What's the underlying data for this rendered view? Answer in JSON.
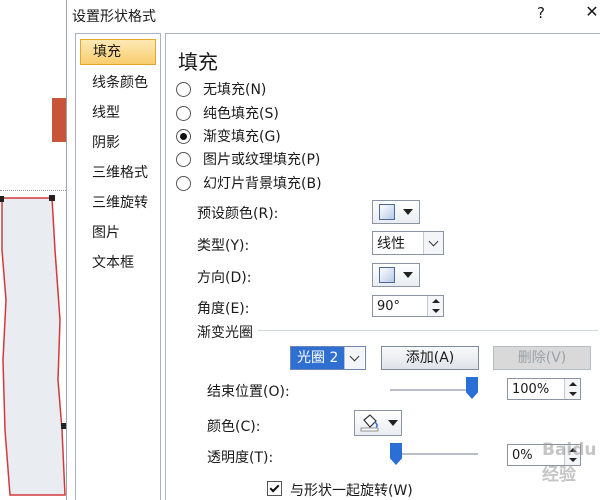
{
  "dialog": {
    "title": "设置形状格式",
    "help": "?"
  },
  "nav": {
    "items": [
      {
        "label": "填充",
        "active": true
      },
      {
        "label": "线条颜色"
      },
      {
        "label": "线型"
      },
      {
        "label": "阴影"
      },
      {
        "label": "三维格式"
      },
      {
        "label": "三维旋转"
      },
      {
        "label": "图片"
      },
      {
        "label": "文本框"
      }
    ]
  },
  "fill": {
    "section_title": "填充",
    "options": [
      {
        "label": "无填充(N)",
        "checked": false
      },
      {
        "label": "纯色填充(S)",
        "checked": false
      },
      {
        "label": "渐变填充(G)",
        "checked": true
      },
      {
        "label": "图片或纹理填充(P)",
        "checked": false
      },
      {
        "label": "幻灯片背景填充(B)",
        "checked": false
      }
    ],
    "preset_label": "预设颜色(R):",
    "type_label": "类型(Y):",
    "type_value": "线性",
    "direction_label": "方向(D):",
    "angle_label": "角度(E):",
    "angle_value": "90°",
    "stops_group": "渐变光圈",
    "stop_value": "光圈 2",
    "add_button": "添加(A)",
    "delete_button": "删除(V)",
    "end_pos_label": "结束位置(O):",
    "end_pos_value": "100%",
    "end_pos_fraction": 1.0,
    "color_label": "颜色(C):",
    "transparency_label": "透明度(T):",
    "transparency_value": "0%",
    "transparency_fraction": 0.0,
    "rotate_with_shape": "与形状一起旋转(W)",
    "rotate_checked": true
  },
  "watermark": "Baidu 经验",
  "colors": {
    "accent": "#2b6fd6",
    "nav_active": "#f9cd6f"
  }
}
